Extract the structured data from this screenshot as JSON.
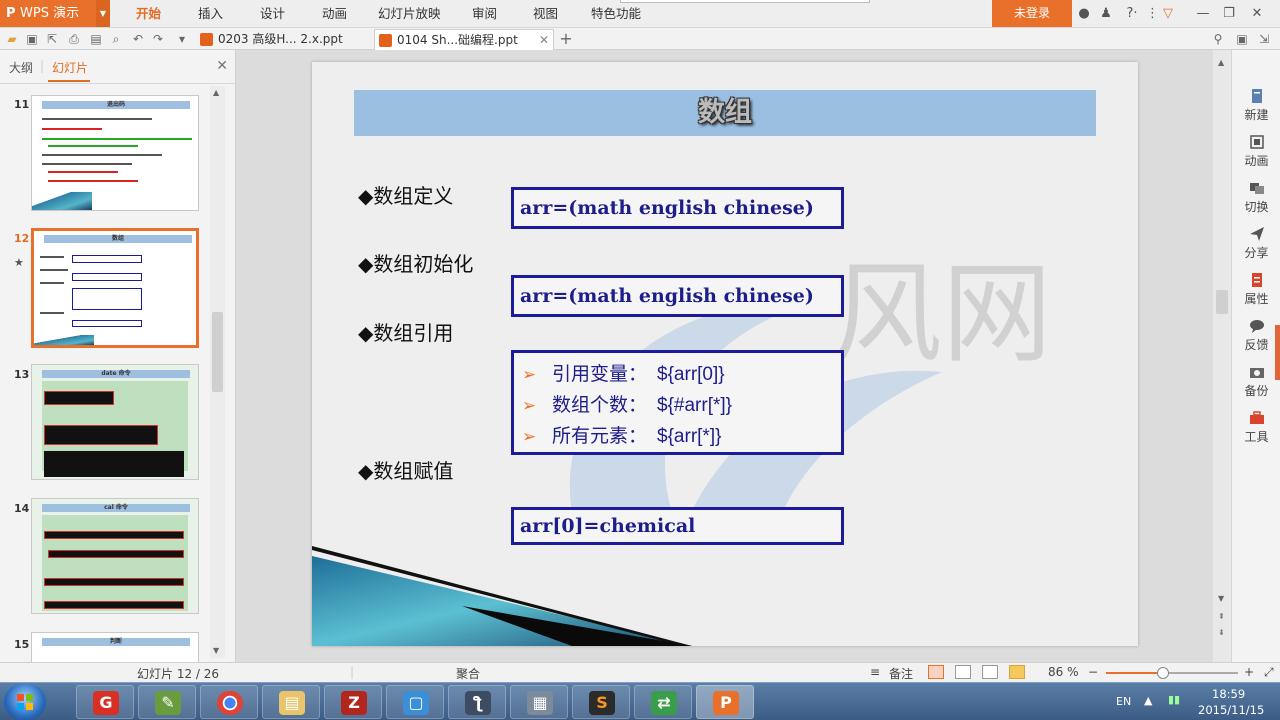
{
  "app": {
    "name": "WPS 演示",
    "login_label": "未登录"
  },
  "menu": {
    "items": [
      "开始",
      "插入",
      "设计",
      "动画",
      "幻灯片放映",
      "审阅",
      "视图",
      "特色功能"
    ],
    "active_index": 0
  },
  "tabs": [
    {
      "label": "0203 高级H... 2.x.ppt",
      "active": false
    },
    {
      "label": "0104 Sh...础编程.ppt",
      "active": true
    }
  ],
  "left_panel": {
    "tab_outline": "大纲",
    "tab_slides": "幻灯片",
    "thumbnails": [
      {
        "num": "11",
        "title": "退出码",
        "selected": false
      },
      {
        "num": "12",
        "title": "数组",
        "selected": true
      },
      {
        "num": "13",
        "title": "date 命令",
        "selected": false
      },
      {
        "num": "14",
        "title": "cal 命令",
        "selected": false
      },
      {
        "num": "15",
        "title": "判断",
        "selected": false
      }
    ]
  },
  "slide": {
    "title": "数组",
    "bullets": [
      "◆数组定义",
      "◆数组初始化",
      "◆数组引用",
      "◆数组赋值"
    ],
    "box_define": "arr=(math english chinese)",
    "box_init": "arr=(math english chinese)",
    "list_items": [
      {
        "label": "引用变量：",
        "code": "${arr[0]}"
      },
      {
        "label": "数组个数：",
        "code": "${#arr[*]}"
      },
      {
        "label": "所有元素：",
        "code": "${arr[*]}"
      }
    ],
    "box_assign": "arr[0]=chemical"
  },
  "right_bar": {
    "items": [
      "新建",
      "动画",
      "切换",
      "分享",
      "属性",
      "反馈",
      "备份",
      "工具"
    ]
  },
  "status": {
    "slide_counter": "幻灯片 12 / 26",
    "theme": "聚合",
    "notes_label": "备注",
    "zoom_label": "86 %",
    "zoom_fraction": 0.43
  },
  "taskbar": {
    "time": "18:59",
    "date": "2015/11/15",
    "ime": "EN"
  },
  "colors": {
    "accent": "#e8702a",
    "title_band": "#9bbfe1",
    "code_text": "#1e1e8a"
  }
}
